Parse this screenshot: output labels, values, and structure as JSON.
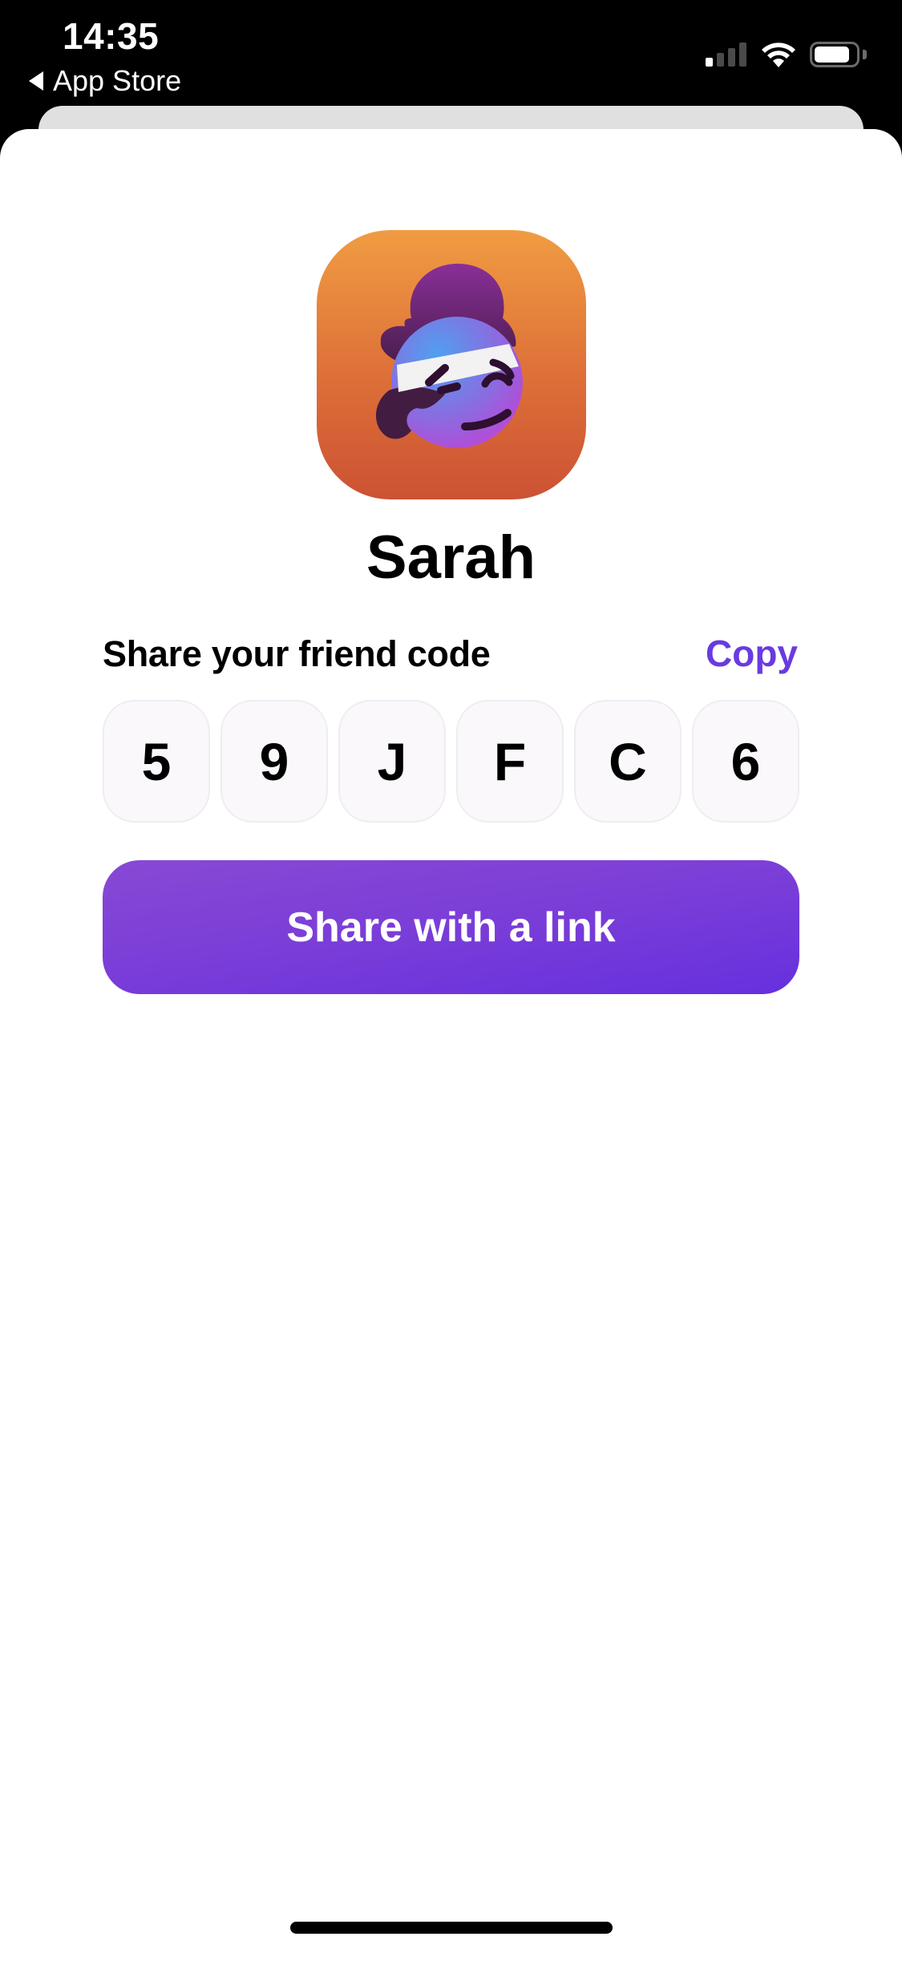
{
  "status_bar": {
    "time": "14:35",
    "back_label": "App Store",
    "signal_bars_active": 1,
    "signal_bars_total": 4,
    "battery_level": 0.85
  },
  "profile": {
    "name": "Sarah",
    "avatar_icon": "winking-face-headband-avatar"
  },
  "friend_code": {
    "label": "Share your friend code",
    "copy_label": "Copy",
    "characters": [
      "5",
      "9",
      "J",
      "F",
      "C",
      "6"
    ]
  },
  "share_button": {
    "label": "Share with a link"
  },
  "colors": {
    "accent": "#6a3ae0",
    "button_top": "#8849d4",
    "button_bottom": "#6530de",
    "avatar_bg_top": "#f09c42",
    "avatar_bg_bottom": "#cc5234"
  }
}
